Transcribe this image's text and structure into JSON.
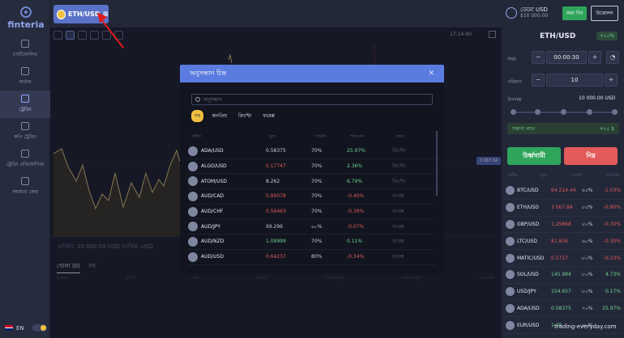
{
  "app": {
    "logo": "finteria"
  },
  "sidebar": {
    "items": [
      {
        "label": "পোর্টফোলিও"
      },
      {
        "label": "অর্ডার"
      },
      {
        "label": "ট্রেডিং"
      },
      {
        "label": "কপি ট্রেডিং"
      },
      {
        "label": "ট্রেডিং প্রতিযোগিতা"
      },
      {
        "label": "সহায়তা কেন্দ্র"
      }
    ],
    "language": "EN"
  },
  "header": {
    "asset": "ETH/USD",
    "balance_label": "ডেমো USD",
    "balance_value": "$10 000.00",
    "deposit": "জমা দিন",
    "withdraw": "উত্তোলন"
  },
  "chart": {
    "time": "17:14:40",
    "price_tag": "3 067.84"
  },
  "bottom": {
    "info": "মার্জিন: 10 000.00 USD  আর্থিক: USD",
    "tab_open": "খোলা (0)",
    "tab_closed": "বন্ধ",
    "headers": [
      "অপশন",
      "প্রতীক",
      "দিক",
      "পরিমাণ",
      "খোলার মূল্য",
      "বর্তমান মূল্য",
      "সময় লাভ"
    ]
  },
  "right_panel": {
    "title": "ETH/USD",
    "badge": "+৫৫%",
    "time_label": "সময়",
    "time_value": "00:00:30",
    "amount_label": "পরিমাণ",
    "amount_value": "10",
    "funds_label": "উপলব্ধ",
    "funds_value": "10 000.00 USD",
    "profit_label": "সম্ভাব্য লাভ",
    "profit_value": "+৮৫ $",
    "up": "উর্ধ্বগামী",
    "down": "নিম্ন",
    "list_headers": [
      "প্রতীক",
      "মূল্য",
      "পেমেন্ট",
      "পরিবর্তন"
    ],
    "rows": [
      {
        "name": "BTC/USD",
        "price": "64 214.44",
        "rate": "৯৫%",
        "change": "-1.03%"
      },
      {
        "name": "ETH/USD",
        "price": "3 067.84",
        "rate": "৮৫%",
        "change": "-0.80%"
      },
      {
        "name": "GBP/USD",
        "price": "1.25868",
        "rate": "৮০%",
        "change": "-0.30%"
      },
      {
        "name": "LTC/USD",
        "price": "81.834",
        "rate": "৬০%",
        "change": "-0.30%"
      },
      {
        "name": "MATIC/USD",
        "price": "0.5717",
        "rate": "৮০%",
        "change": "-0.23%"
      },
      {
        "name": "SOL/USD",
        "price": "145.984",
        "rate": "৮০%",
        "change": "4.73%"
      },
      {
        "name": "USD/JPY",
        "price": "154.657",
        "rate": "৮০%",
        "change": "0.17%"
      },
      {
        "name": "ADA/USD",
        "price": "0.58375",
        "rate": "৭০%",
        "change": "25.97%"
      },
      {
        "name": "EUR/USD",
        "price": "1.08",
        "rate": "৮০%",
        "change": ""
      }
    ]
  },
  "modal": {
    "title": "অনুসন্ধান চিহ্ন",
    "search_placeholder": "অনুসন্ধান",
    "categories": [
      "সব",
      "জনপ্রিয়",
      "ক্রিপ্টো",
      "ফরেক্স"
    ],
    "headers": [
      "প্রতীক",
      "মূল্য",
      "পেমেন্ট",
      "পরিবর্তন",
      "প্রকার"
    ],
    "rows": [
      {
        "name": "ADA/USD",
        "price": "0.58375",
        "rate": "70%",
        "change": "25.97%",
        "type": "ক্রিপ্টো",
        "pc": "neutral",
        "cc": "pos"
      },
      {
        "name": "ALGO/USD",
        "price": "0.17747",
        "rate": "70%",
        "change": "2.36%",
        "type": "ক্রিপ্টো",
        "pc": "neg",
        "cc": "pos"
      },
      {
        "name": "ATOM/USD",
        "price": "8.262",
        "rate": "70%",
        "change": "6.79%",
        "type": "ক্রিপ্টো",
        "pc": "neutral",
        "cc": "pos"
      },
      {
        "name": "AUD/CAD",
        "price": "0.89078",
        "rate": "70%",
        "change": "-0.40%",
        "type": "ফরেক্স",
        "pc": "neg",
        "cc": "neg"
      },
      {
        "name": "AUD/CHF",
        "price": "0.59463",
        "rate": "70%",
        "change": "-0.39%",
        "type": "ফরেক্স",
        "pc": "neg",
        "cc": "neg"
      },
      {
        "name": "AUD/JPY",
        "price": "99.296",
        "rate": "৬০%",
        "change": "-0.07%",
        "type": "ফরেক্স",
        "pc": "neutral",
        "cc": "neg"
      },
      {
        "name": "AUD/NZD",
        "price": "1.09999",
        "rate": "70%",
        "change": "0.11%",
        "type": "ফরেক্স",
        "pc": "pos",
        "cc": "pos"
      },
      {
        "name": "AUD/USD",
        "price": "0.64237",
        "rate": "80%",
        "change": "-0.34%",
        "type": "ফরেক্স",
        "pc": "neg",
        "cc": "neg"
      }
    ]
  },
  "watermark": "trading-everyday.com"
}
